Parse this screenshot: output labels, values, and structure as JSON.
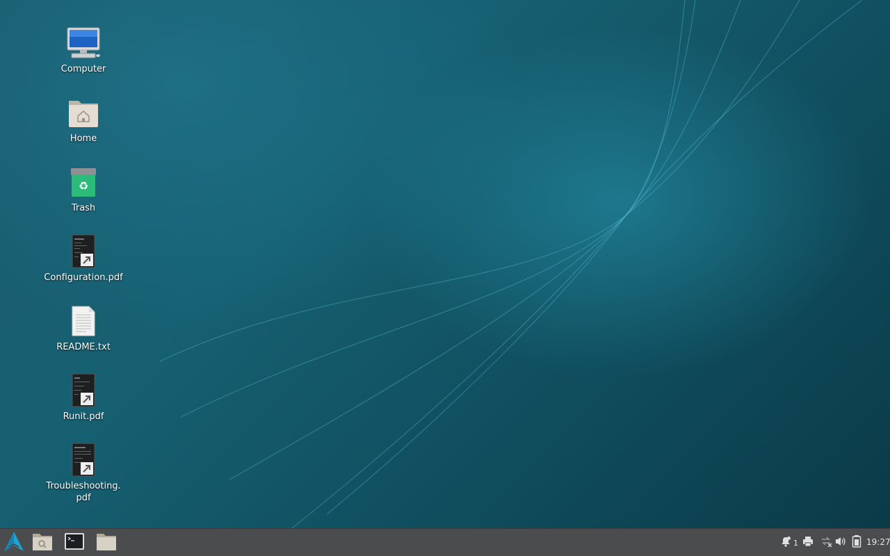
{
  "desktop": {
    "icons": [
      {
        "label": "Computer",
        "icon": "computer-icon"
      },
      {
        "label": "Home",
        "icon": "home-folder-icon"
      },
      {
        "label": "Trash",
        "icon": "trash-icon"
      },
      {
        "label": "Configuration.pdf",
        "icon": "pdf-shortcut-icon"
      },
      {
        "label": "README.txt",
        "icon": "text-file-icon"
      },
      {
        "label": "Runit.pdf",
        "icon": "pdf-shortcut-icon"
      },
      {
        "label": "Troubleshooting.\npdf",
        "icon": "pdf-shortcut-icon"
      }
    ]
  },
  "taskbar": {
    "launchers": [
      "app-menu-icon",
      "file-manager-search-icon",
      "terminal-icon",
      "folder-icon"
    ],
    "tray": {
      "notification_count": "1",
      "icons": [
        "notification-bell-icon",
        "printer-icon",
        "network-disconnected-icon",
        "volume-icon",
        "battery-icon"
      ],
      "clock": "19:27"
    }
  },
  "colors": {
    "taskbar_bg": "#4a4c4d",
    "desktop_bg": "#166072",
    "accent": "#1fa3d6"
  }
}
